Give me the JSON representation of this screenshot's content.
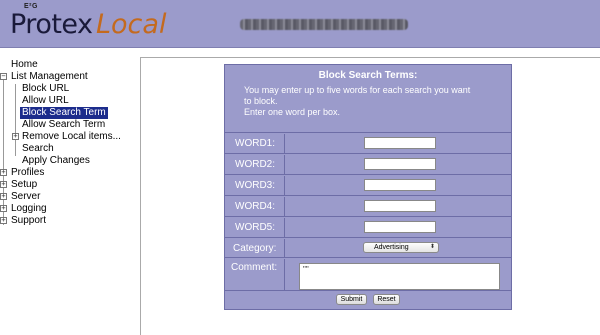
{
  "header": {
    "logo_small": "E²G",
    "logo_protex": "Protex",
    "logo_local": "Local"
  },
  "sidebar": {
    "items": [
      {
        "label": "Home"
      },
      {
        "label": "List Management"
      },
      {
        "label": "Block URL"
      },
      {
        "label": "Allow URL"
      },
      {
        "label": "Block Search Term"
      },
      {
        "label": "Allow Search Term"
      },
      {
        "label": "Remove Local items..."
      },
      {
        "label": "Search"
      },
      {
        "label": "Apply Changes"
      },
      {
        "label": "Profiles"
      },
      {
        "label": "Setup"
      },
      {
        "label": "Server"
      },
      {
        "label": "Logging"
      },
      {
        "label": "Support"
      }
    ]
  },
  "form": {
    "title": "Block Search Terms:",
    "desc_line1": "You may enter up to five words for each search you want",
    "desc_line2": "to block.",
    "desc_line3": "Enter one word per box.",
    "word1_label": "WORD1:",
    "word2_label": "WORD2:",
    "word3_label": "WORD3:",
    "word4_label": "WORD4:",
    "word5_label": "WORD5:",
    "word1_value": "",
    "word2_value": "",
    "word3_value": "",
    "word4_value": "",
    "word5_value": "",
    "category_label": "Category:",
    "category_value": "Advertising",
    "comment_label": "Comment:",
    "comment_value": "\"\"",
    "submit_label": "Submit",
    "reset_label": "Reset"
  },
  "colors": {
    "header_bg": "#9b9bcb",
    "panel_bg": "#9b9bcb",
    "logo_local": "#c46a1e",
    "selected_bg": "#1c2c8c"
  },
  "icons": [
    "expand-toggle-icon",
    "collapse-toggle-icon",
    "select-arrow-icon"
  ]
}
